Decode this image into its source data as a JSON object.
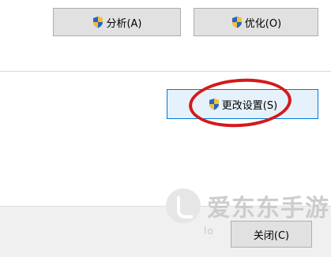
{
  "top_buttons": {
    "analyze_label": "分析(A)",
    "optimize_label": "优化(O)"
  },
  "settings": {
    "change_settings_label": "更改设置(S)"
  },
  "footer": {
    "close_label": "关闭(C)"
  },
  "watermark": {
    "brand": "爱东东手游",
    "sub": "lo"
  },
  "colors": {
    "annotation_circle": "#d4191b",
    "focused_border": "#0078d7"
  },
  "icons": {
    "uac": "uac-shield-icon"
  }
}
